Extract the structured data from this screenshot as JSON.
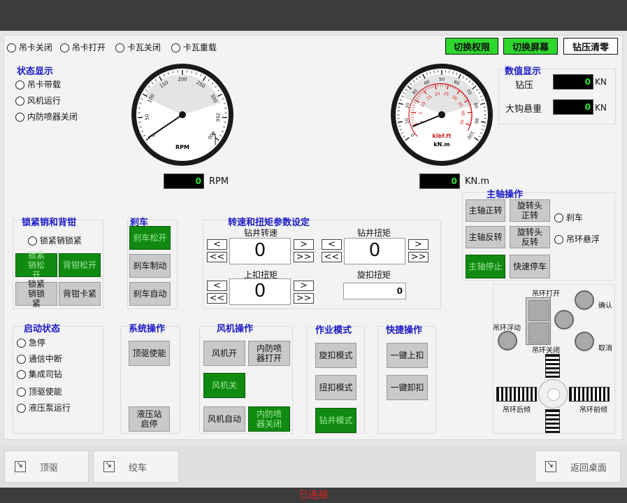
{
  "top_radios": [
    "吊卡关闭",
    "吊卡打开",
    "卡瓦关闭",
    "卡瓦重载"
  ],
  "top_buttons": {
    "switch_perm": "切换权限",
    "switch_screen": "切换屏幕",
    "wob_zero": "钻压清零"
  },
  "status_display": {
    "title": "状态显示",
    "items": [
      "吊卡带载",
      "风机运行",
      "内防喷器关闭"
    ]
  },
  "gauge_rpm": {
    "ticks": [
      "0",
      "50",
      "100",
      "150",
      "200",
      "250",
      "300",
      "350",
      "400"
    ],
    "unit": "RPM",
    "readout": "0",
    "readout_unit": "RPM"
  },
  "gauge_torque": {
    "ticks": [
      "0",
      "10",
      "20",
      "30",
      "40",
      "50",
      "60",
      "70",
      "80",
      "90",
      "100"
    ],
    "inner_ticks": [
      "0",
      "5",
      "10",
      "15",
      "20",
      "25",
      "30",
      "35",
      "40",
      "45"
    ],
    "unit1": "klbf.ft",
    "unit2": "kN.m",
    "readout": "0",
    "readout_unit": "KN.m"
  },
  "numeric_display": {
    "title": "数值显示",
    "wob_label": "钻压",
    "wob_value": "0",
    "wob_unit": "KN",
    "hook_label": "大钩悬重",
    "hook_value": "0",
    "hook_unit": "KN"
  },
  "spindle": {
    "title": "主轴操作",
    "fwd": "主轴正转",
    "rev": "主轴反转",
    "stop": "主轴停止",
    "head_fwd": "旋转头正转",
    "head_rev": "旋转头反转",
    "quick_stop": "快速停车",
    "brake_radio": "刹车",
    "ring_radio": "吊环悬浮"
  },
  "lock": {
    "title": "锁紧销和背钳",
    "radio": "锁紧销锁紧",
    "unlock": "锁紧销松开",
    "back_release": "背钳松开",
    "lock_btn": "锁紧销锁紧",
    "back_clamp": "背钳卡紧"
  },
  "brake": {
    "title": "刹车",
    "release": "刹车松开",
    "apply": "刹车制动",
    "auto": "刹车自动"
  },
  "params": {
    "title": "转速和扭矩参数设定",
    "speed_label": "钻井转速",
    "speed": "0",
    "torque_label": "钻井扭矩",
    "torque": "0",
    "makeup_label": "上扣扭矩",
    "makeup": "0",
    "spin_label": "旋扣扭矩",
    "spin": "0",
    "lt": "<",
    "ltlt": "<<",
    "gt": ">",
    "gtgt": ">>"
  },
  "start_status": {
    "title": "启动状态",
    "items": [
      "急停",
      "通信中断",
      "集成司钻",
      "顶驱使能",
      "液压泵运行"
    ]
  },
  "system_ops": {
    "title": "系统操作",
    "td_enable": "顶驱使能",
    "hyd": "液压站启停"
  },
  "fan_ops": {
    "title": "风机操作",
    "fan_on": "风机开",
    "ibop_open": "内防喷器打开",
    "fan_off": "风机关",
    "fan_auto": "风机自动",
    "ibop_close": "内防喷器关闭"
  },
  "work_mode": {
    "title": "作业模式",
    "spin": "旋扣模式",
    "torque": "扭扣模式",
    "drill": "钻井模式"
  },
  "quick_ops": {
    "title": "快捷操作",
    "makeup": "一键上扣",
    "breakout": "一键卸扣"
  },
  "joystick": {
    "ring_open": "吊环打开",
    "confirm": "确认",
    "ring_float": "吊环浮动",
    "ring_close": "吊环关闭",
    "cancel": "取消",
    "ring_back": "吊环后倾",
    "ring_fwd": "吊环前倾"
  },
  "nav": {
    "topdrive": "顶驱",
    "winch": "绞车",
    "desktop": "返回桌面"
  },
  "status_bar": "已连接"
}
